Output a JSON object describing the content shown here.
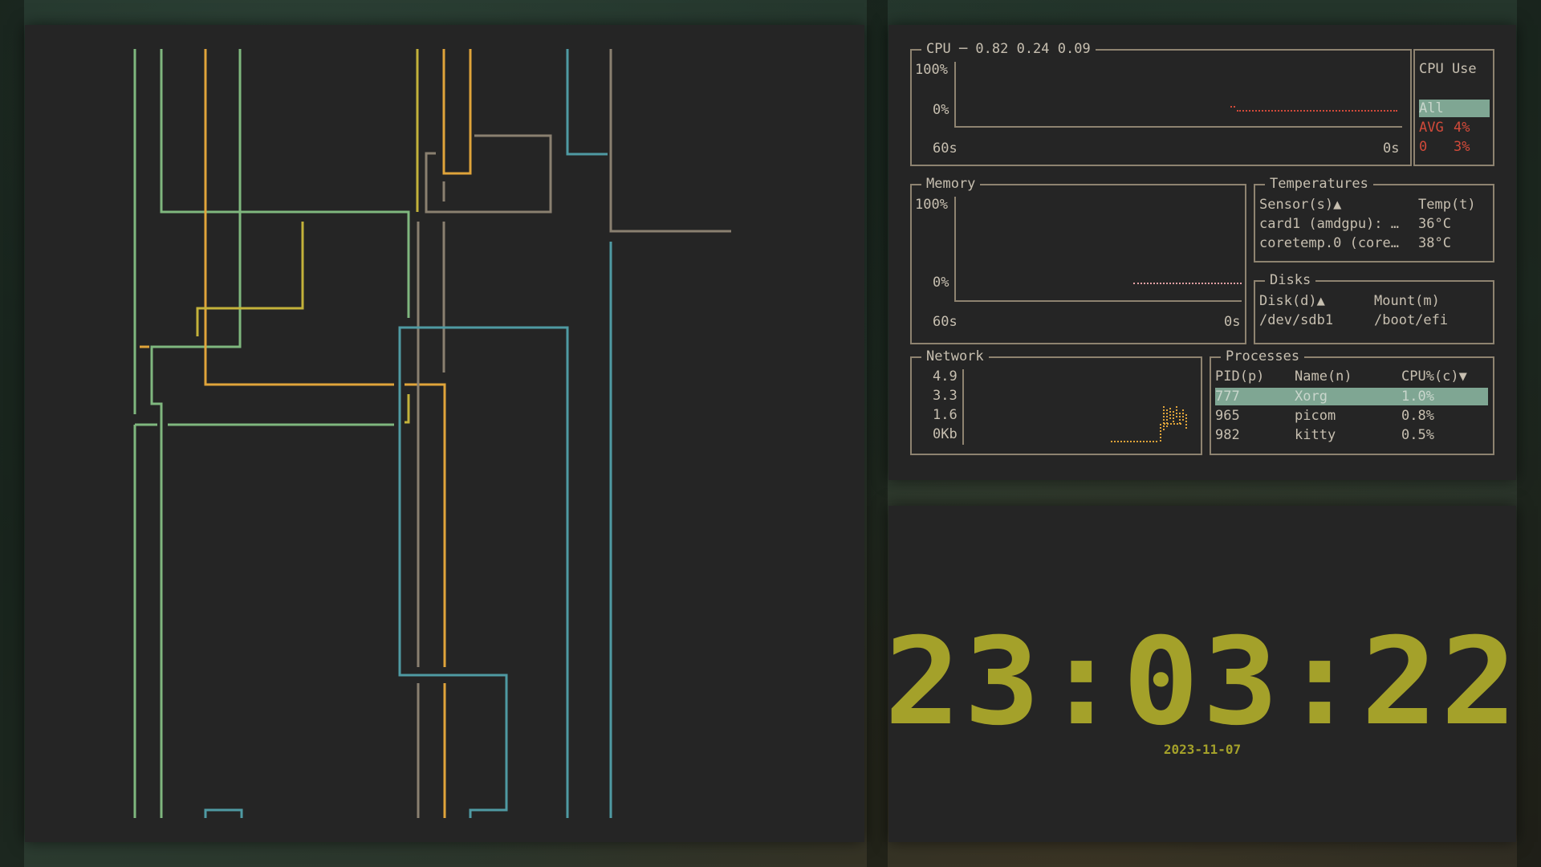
{
  "colors": {
    "pipe_green": "#7fb77e",
    "pipe_orange": "#e0a43a",
    "pipe_yellow": "#c4b23a",
    "pipe_gray": "#8a8070",
    "pipe_teal": "#4f9aa3",
    "box_border": "#8e8370",
    "text": "#c7bfb0",
    "highlight": "#7fa693",
    "red": "#d24a3a",
    "clock": "#a4a12a"
  },
  "pipes": {
    "title": ""
  },
  "cpu": {
    "title": "CPU ─ 0.82 0.24 0.09",
    "y_max": "100%",
    "y_min": "0%",
    "x_left": "60s",
    "x_right": "0s",
    "use_panel": {
      "title": "CPU Use",
      "rows": [
        {
          "label": "All",
          "value": "",
          "selected": true
        },
        {
          "label": "AVG",
          "value": "4%"
        },
        {
          "label": "0",
          "value": "3%"
        }
      ]
    }
  },
  "memory": {
    "title": "Memory",
    "y_max": "100%",
    "y_min": "0%",
    "x_left": "60s",
    "x_right": "0s"
  },
  "temperatures": {
    "title": "Temperatures",
    "headers": [
      "Sensor(s)▲",
      "Temp(t)"
    ],
    "rows": [
      [
        "card1 (amdgpu): …",
        "36°C"
      ],
      [
        "coretemp.0 (core…",
        "38°C"
      ]
    ]
  },
  "disks": {
    "title": "Disks",
    "headers": [
      "Disk(d)▲",
      "Mount(m)"
    ],
    "rows": [
      [
        "/dev/sdb1",
        "/boot/efi"
      ]
    ]
  },
  "network": {
    "title": "Network",
    "ticks": [
      "4.9",
      "3.3",
      "1.6",
      "0Kb"
    ]
  },
  "processes": {
    "title": "Processes",
    "headers": [
      "PID(p)",
      "Name(n)",
      "CPU%(c)▼"
    ],
    "rows": [
      [
        "777",
        "Xorg",
        "1.0%"
      ],
      [
        "965",
        "picom",
        "0.8%"
      ],
      [
        "982",
        "kitty",
        "0.5%"
      ]
    ]
  },
  "clock": {
    "time": "23:03:22",
    "date": "2023-11-07"
  }
}
